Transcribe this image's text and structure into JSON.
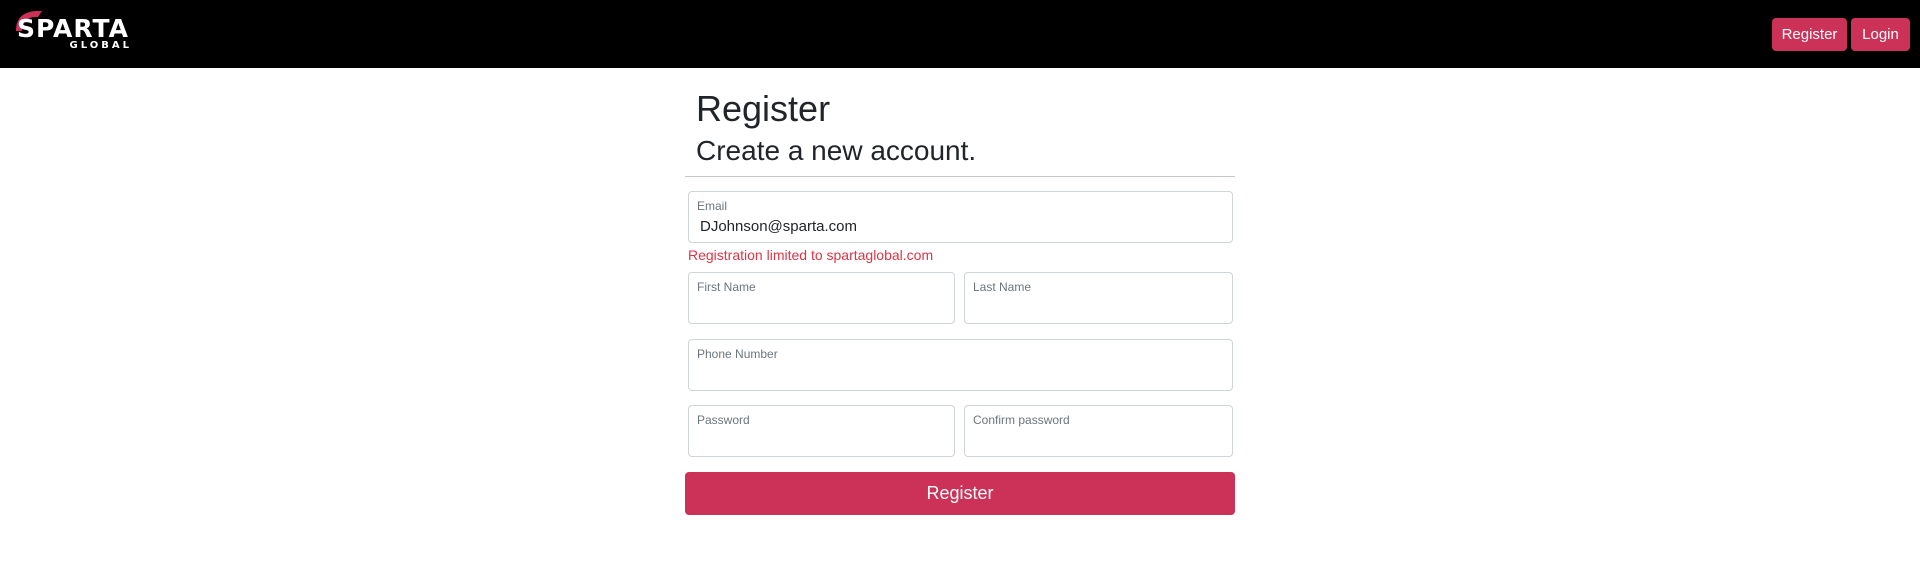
{
  "brand": {
    "logo_main": "SPARTA",
    "logo_sub": "GLOBAL",
    "accent_color": "#cc3157"
  },
  "nav": {
    "register_label": "Register",
    "login_label": "Login"
  },
  "page": {
    "title": "Register",
    "subtitle": "Create a new account."
  },
  "form": {
    "email": {
      "label": "Email",
      "value": "DJohnson@sparta.com"
    },
    "email_error": "Registration limited to spartaglobal.com",
    "first_name": {
      "label": "First Name",
      "value": ""
    },
    "last_name": {
      "label": "Last Name",
      "value": ""
    },
    "phone": {
      "label": "Phone Number",
      "value": ""
    },
    "password": {
      "label": "Password",
      "value": ""
    },
    "confirm_password": {
      "label": "Confirm password",
      "value": ""
    },
    "submit_label": "Register"
  }
}
